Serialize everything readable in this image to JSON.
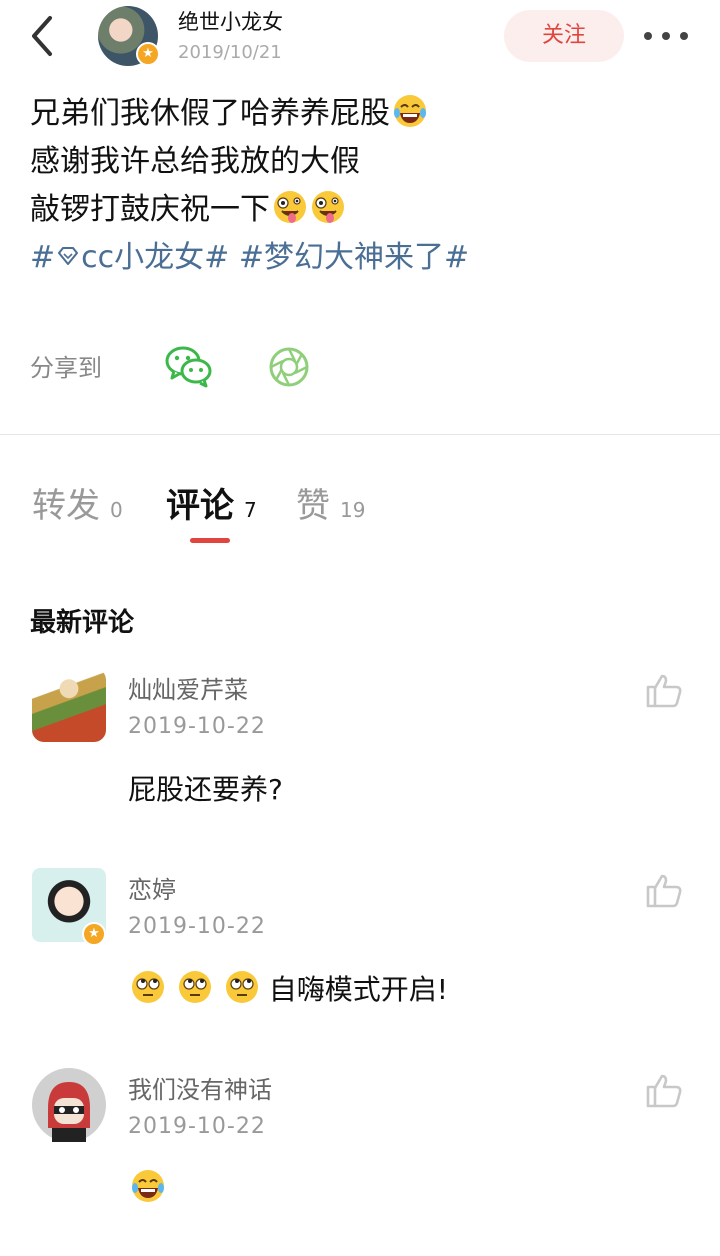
{
  "header": {
    "author_name": "绝世小龙女",
    "post_date": "2019/10/21",
    "follow_label": "关注",
    "icons": {
      "back": "chevron-left-icon",
      "more": "more-dots-icon",
      "verified": "star-badge-icon"
    }
  },
  "post": {
    "lines": [
      "兄弟们我休假了哈养养屁股",
      "感谢我许总给我放的大假",
      "敲锣打鼓庆祝一下"
    ],
    "tags": [
      "#",
      "cc小龙女#",
      "#梦幻大神来了#"
    ],
    "emojis": [
      "laughing-tears-emoji",
      "zany-face-emoji"
    ]
  },
  "share": {
    "label": "分享到",
    "targets": [
      "wechat-icon",
      "moments-icon"
    ],
    "colors": {
      "wechat": "#3cb84a",
      "moments": "#8fcf7a"
    }
  },
  "tabs": [
    {
      "label": "转发",
      "count": "0"
    },
    {
      "label": "评论",
      "count": "7",
      "active": true
    },
    {
      "label": "赞",
      "count": "19"
    }
  ],
  "section_title": "最新评论",
  "comments": [
    {
      "name": "灿灿爱芹菜",
      "date": "2019-10-22",
      "text": "屁股还要养?"
    },
    {
      "name": "恋婷",
      "date": "2019-10-22",
      "text": "自嗨模式开启!",
      "verified": true
    },
    {
      "name": "我们没有神话",
      "date": "2019-10-22",
      "text": ""
    }
  ],
  "colors": {
    "accent": "#e0463e",
    "follow_bg": "#fdeeee",
    "tag": "#4a6e94",
    "badge": "#f5a623"
  }
}
